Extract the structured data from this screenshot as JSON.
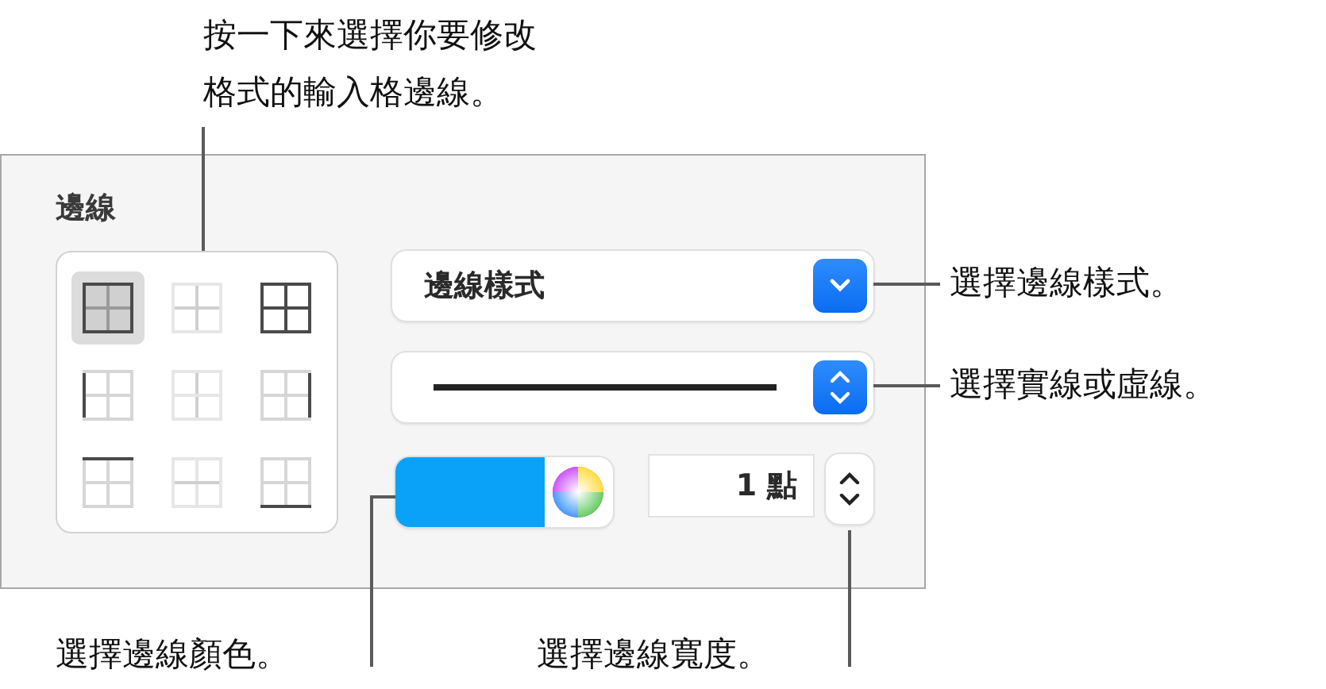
{
  "panel": {
    "title": "邊線",
    "border_buttons": [
      {
        "kind": "all",
        "selected": true
      },
      {
        "kind": "inside",
        "selected": false
      },
      {
        "kind": "outside",
        "selected": false
      },
      {
        "kind": "left",
        "selected": false
      },
      {
        "kind": "vertical",
        "selected": false
      },
      {
        "kind": "right",
        "selected": false
      },
      {
        "kind": "top",
        "selected": false
      },
      {
        "kind": "horizontal",
        "selected": false
      },
      {
        "kind": "bottom",
        "selected": false
      }
    ],
    "border_style": {
      "value": "邊線樣式"
    },
    "line_style": {
      "kind": "solid"
    },
    "color_well": {
      "color": "#0aa2f8"
    },
    "width_field": {
      "value": "1 點"
    }
  },
  "callouts": [
    {
      "text": "按一下來選擇你要修改格式的輸入格邊線。"
    },
    {
      "text": "選擇邊線樣式。"
    },
    {
      "text": "選擇實線或虛線。"
    },
    {
      "text": "選擇邊線顏色。"
    },
    {
      "text": "選擇邊線寬度。"
    }
  ]
}
